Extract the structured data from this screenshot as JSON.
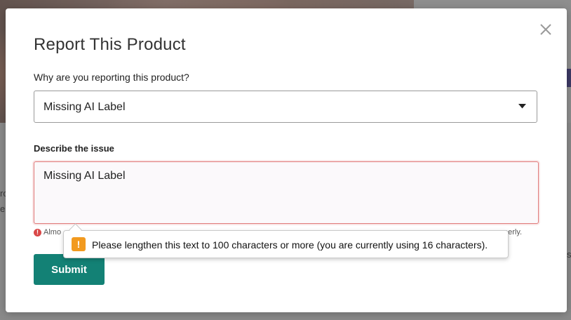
{
  "background": {
    "left_text_1": "ro",
    "left_text_2": "e",
    "right_text_1": "s"
  },
  "modal": {
    "title": "Report This Product",
    "close_icon": "close-icon"
  },
  "form": {
    "reason_label": "Why are you reporting this product?",
    "reason_selected": "Missing AI Label",
    "describe_label": "Describe the issue",
    "describe_value": "Missing AI Label",
    "error_text_start": "Almo",
    "error_text_end": "perly.",
    "submit_label": "Submit"
  },
  "tooltip": {
    "icon_glyph": "!",
    "message": "Please lengthen this text to 100 characters or more (you are currently using 16 characters)."
  },
  "colors": {
    "accent": "#138175",
    "error": "#d94848",
    "warning": "#f29a1f"
  }
}
